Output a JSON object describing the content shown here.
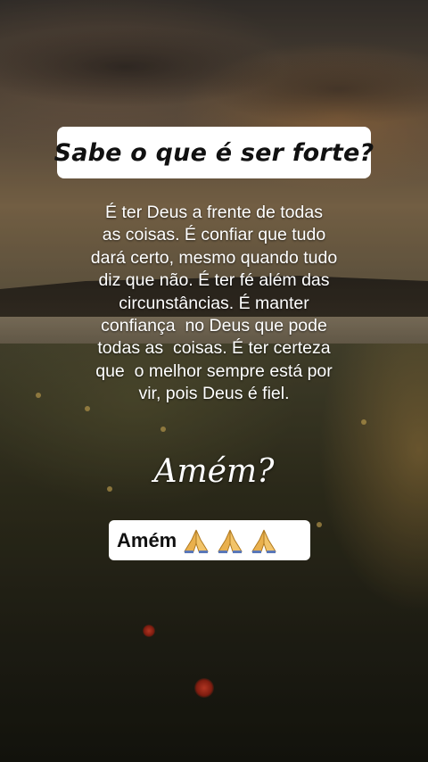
{
  "title": "Sabe o que é ser forte?",
  "body_lines": [
    "É ter Deus a frente de todas",
    "as coisas. É confiar que tudo",
    "dará certo, mesmo quando tudo",
    "diz que não. É ter fé além das",
    "circunstâncias. É manter",
    "confiança  no Deus que pode",
    "todas as  coisas. É ter certeza",
    "que  o melhor sempre está por",
    "vir, pois Deus é fiel."
  ],
  "prompt": "Amém?",
  "reply": {
    "text": "Amém",
    "icons": [
      "praying-hands-icon",
      "praying-hands-icon",
      "praying-hands-icon"
    ]
  },
  "colors": {
    "box": "#ffffff",
    "text_light": "#ffffff",
    "text_dark": "#111111",
    "icon_skin": "#e9b04d"
  }
}
